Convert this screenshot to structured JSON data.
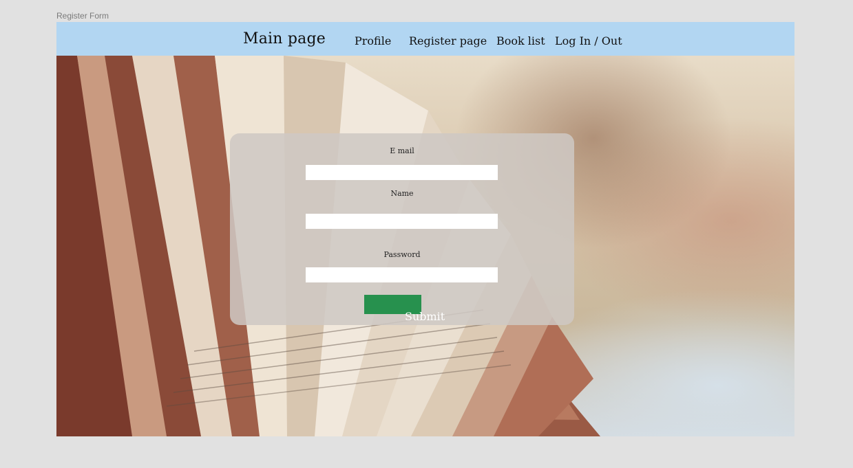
{
  "canvas": {
    "frame_label": "Register Form"
  },
  "navbar": {
    "brand": "Main page",
    "links": [
      "Profile",
      "Register page",
      "Book list",
      "Log In / Out"
    ]
  },
  "form": {
    "email_label": "E mail",
    "name_label": "Name",
    "password_label": "Password",
    "submit_label": "Submit"
  },
  "colors": {
    "navbar_bg": "#b2d6f2",
    "submit_bg": "#27914e",
    "canvas_bg": "#e1e1e1"
  }
}
